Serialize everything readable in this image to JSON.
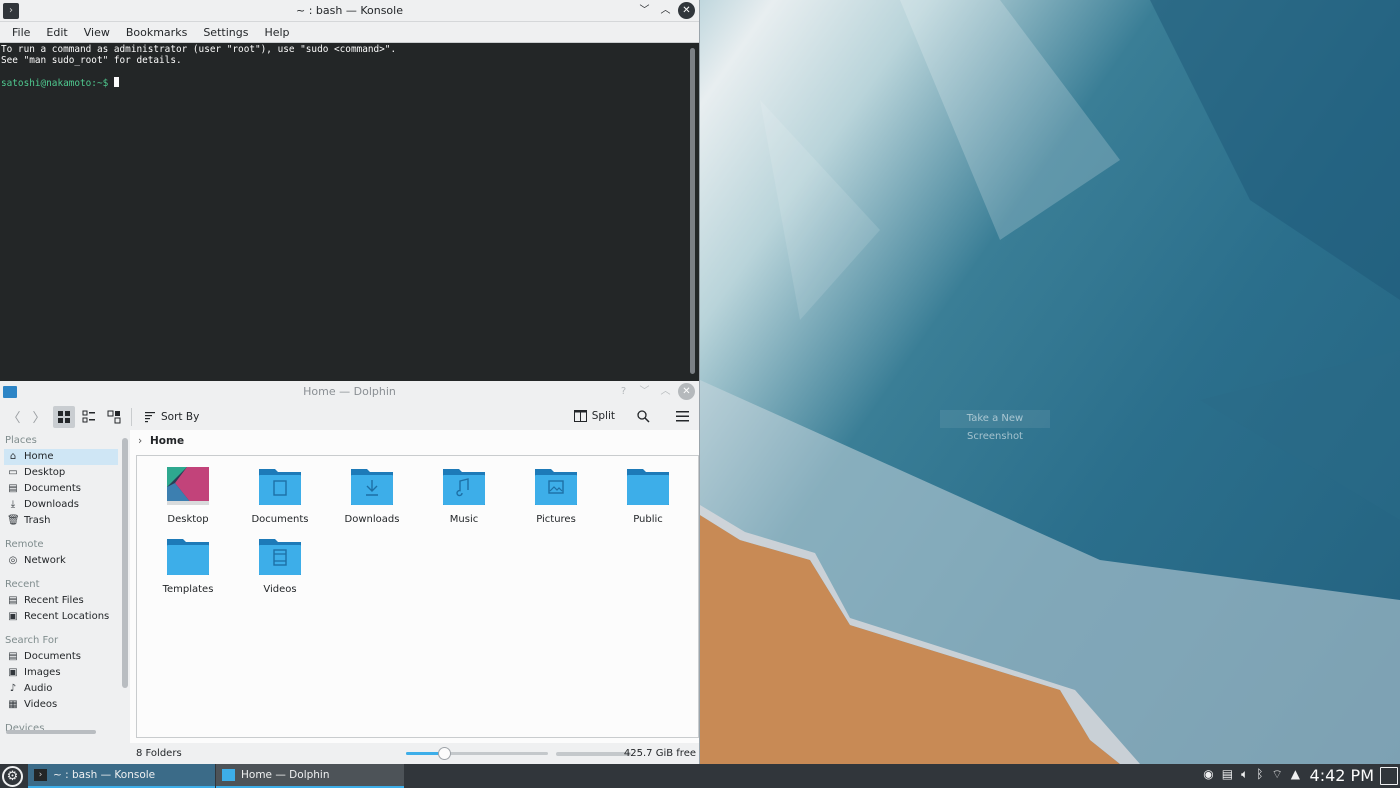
{
  "desktop": {
    "screenshot_tip": "Take a New Screenshot"
  },
  "konsole": {
    "title": "~ : bash — Konsole",
    "menu": [
      "File",
      "Edit",
      "View",
      "Bookmarks",
      "Settings",
      "Help"
    ],
    "terminal": {
      "line1": "To run a command as administrator (user \"root\"), use \"sudo <command>\".",
      "line2": "See \"man sudo_root\" for details.",
      "prompt": "satoshi@nakamoto:~$ "
    }
  },
  "dolphin": {
    "title": "Home — Dolphin",
    "toolbar": {
      "sort_label": "Sort By",
      "split_label": "Split"
    },
    "places": {
      "sections": [
        {
          "header": "Places",
          "items": [
            {
              "label": "Home",
              "icon": "home-icon",
              "selected": true
            },
            {
              "label": "Desktop",
              "icon": "desktop-icon"
            },
            {
              "label": "Documents",
              "icon": "documents-icon"
            },
            {
              "label": "Downloads",
              "icon": "downloads-icon"
            },
            {
              "label": "Trash",
              "icon": "trash-icon"
            }
          ]
        },
        {
          "header": "Remote",
          "items": [
            {
              "label": "Network",
              "icon": "network-icon"
            }
          ]
        },
        {
          "header": "Recent",
          "items": [
            {
              "label": "Recent Files",
              "icon": "recent-files-icon"
            },
            {
              "label": "Recent Locations",
              "icon": "recent-locations-icon"
            }
          ]
        },
        {
          "header": "Search For",
          "items": [
            {
              "label": "Documents",
              "icon": "search-documents-icon"
            },
            {
              "label": "Images",
              "icon": "images-icon"
            },
            {
              "label": "Audio",
              "icon": "audio-icon"
            },
            {
              "label": "Videos",
              "icon": "videos-icon"
            }
          ]
        },
        {
          "header": "Devices",
          "items": []
        }
      ]
    },
    "breadcrumb": "Home",
    "folders": [
      {
        "label": "Desktop",
        "icon": "desktop-folder-icon"
      },
      {
        "label": "Documents",
        "icon": "documents-folder-icon"
      },
      {
        "label": "Downloads",
        "icon": "downloads-folder-icon"
      },
      {
        "label": "Music",
        "icon": "music-folder-icon"
      },
      {
        "label": "Pictures",
        "icon": "pictures-folder-icon"
      },
      {
        "label": "Public",
        "icon": "public-folder-icon"
      },
      {
        "label": "Templates",
        "icon": "templates-folder-icon"
      },
      {
        "label": "Videos",
        "icon": "videos-folder-icon"
      }
    ],
    "status": {
      "count": "8 Folders",
      "free_space": "425.7 GiB free",
      "zoom_level_fraction": 0.27
    }
  },
  "taskbar": {
    "tasks": [
      {
        "label": "~ : bash — Konsole",
        "icon": "konsole-icon"
      },
      {
        "label": "Home — Dolphin",
        "icon": "dolphin-icon"
      }
    ],
    "clock": "4:42 PM"
  },
  "colors": {
    "accent": "#3daee9",
    "folder": "#3daee9",
    "terminal_bg": "#232627",
    "prompt": "#4fc98f",
    "taskbar": "#31363b"
  }
}
